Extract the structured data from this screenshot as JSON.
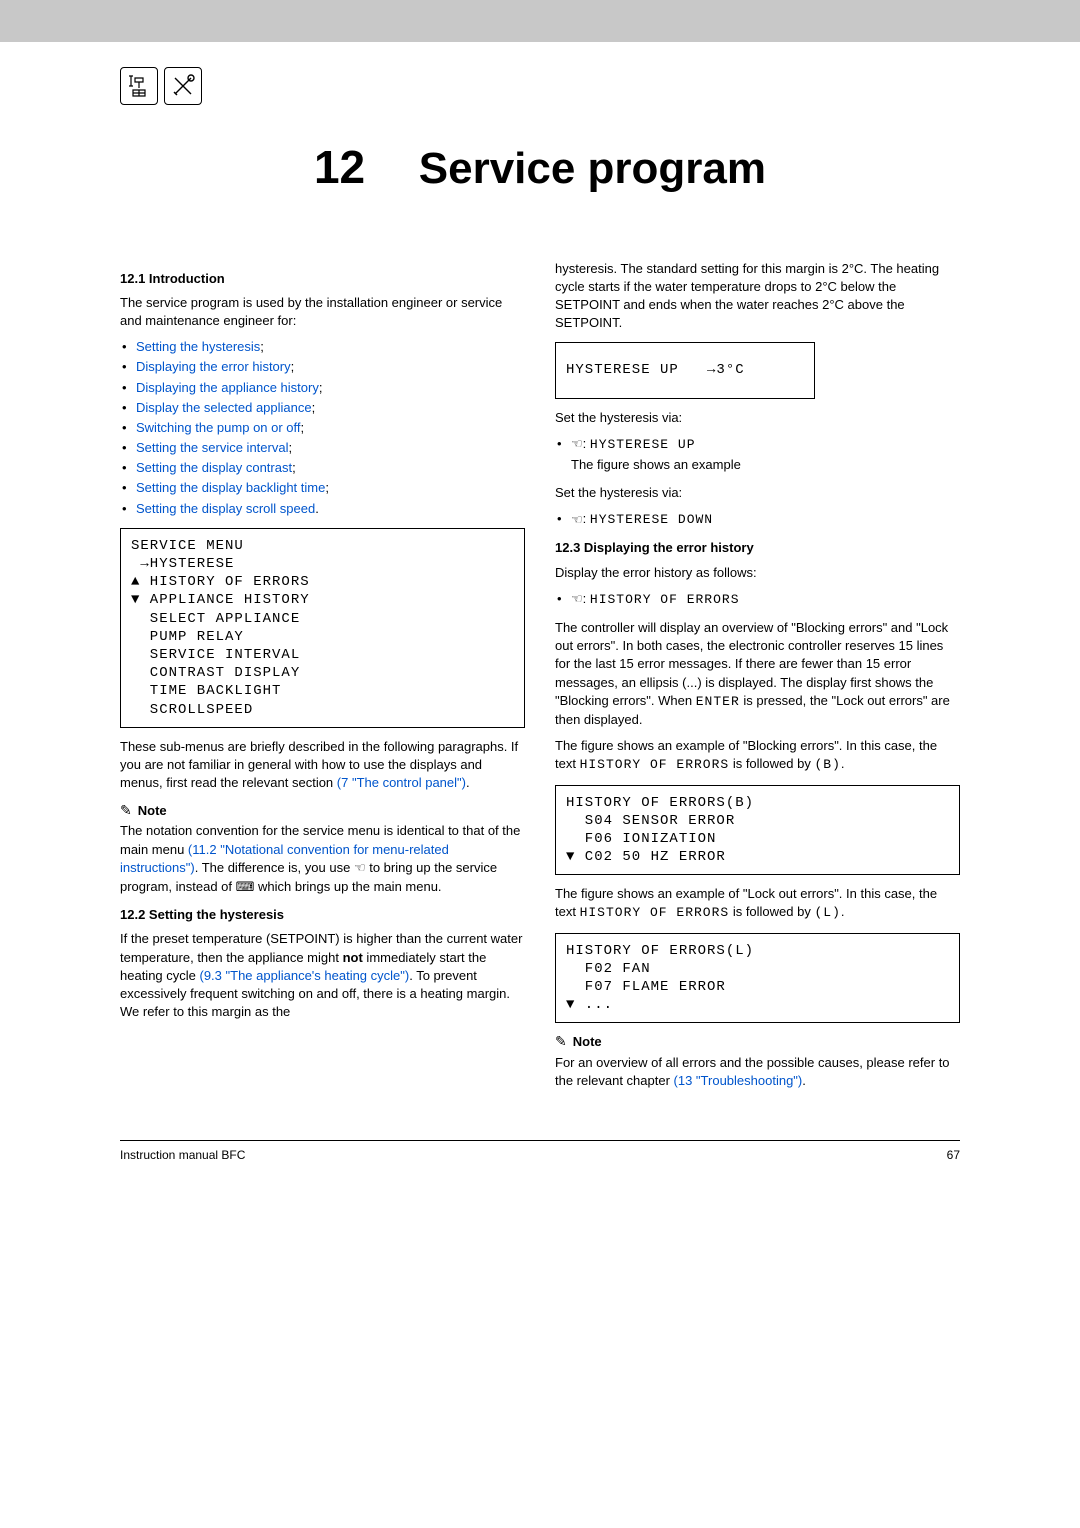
{
  "chapter": {
    "number": "12",
    "title": "Service program"
  },
  "s12_1": {
    "heading": "12.1   Introduction",
    "intro": "The service program is used by the installation engineer or service and maintenance engineer for:",
    "items": [
      "Setting the hysteresis",
      "Displaying the error history",
      "Displaying the appliance history",
      "Display the selected appliance",
      "Switching the pump on or off",
      "Setting the service interval",
      "Setting the display contrast",
      "Setting the display backlight time",
      "Setting the display scroll speed"
    ],
    "lcd": "SERVICE MENU\n →HYSTERESE\n▲ HISTORY OF ERRORS\n▼ APPLIANCE HISTORY\n  SELECT APPLIANCE\n  PUMP RELAY\n  SERVICE INTERVAL\n  CONTRAST DISPLAY\n  TIME BACKLIGHT\n  SCROLLSPEED",
    "after_lcd_1": "These sub-menus are briefly described in the following paragraphs. If you are not familiar in general with how to use the displays and menus, first read the relevant section ",
    "after_lcd_link": "(7 \"The control panel\")",
    "after_lcd_2": ".",
    "note_title": "Note",
    "note_1": "The notation convention for the service menu is identical to that of the main menu ",
    "note_link": "(11.2 \"Notational convention for menu-related instructions\")",
    "note_2": ". The difference is, you use ",
    "note_3": " to bring up the service program, instead of ",
    "note_4": " which brings up the main menu."
  },
  "s12_2": {
    "heading": "12.2   Setting the hysteresis",
    "p1_a": "If the preset temperature (SETPOINT) is higher than the current water temperature, then the appliance might ",
    "p1_bold": "not",
    "p1_b": " immediately start the heating cycle ",
    "p1_link": "(9.3 \"The appliance's heating cycle\")",
    "p1_c": ". To prevent excessively frequent switching on and off, there is a heating margin. We refer to this margin as the",
    "p2": "hysteresis. The standard setting for this margin is 2°C. The heating cycle starts if the water temperature drops to 2°C below the SETPOINT and ends when the water reaches 2°C above the SETPOINT.",
    "lcd": "HYSTERESE UP   →3°C",
    "set_via": "Set the hysteresis via:",
    "bul1": "HYSTERESE UP",
    "example": "The figure shows an example",
    "set_via2": "Set the hysteresis via:",
    "bul2": "HYSTERESE DOWN"
  },
  "s12_3": {
    "heading": "12.3   Displaying the error history",
    "intro": "Display the error history as follows:",
    "bul1": "HISTORY OF ERRORS",
    "p1_a": "The controller will display an overview of \"Blocking errors\" and \"Lock out errors\". In both cases, the electronic controller reserves 15 lines for the last 15 error messages. If there are fewer than 15 error messages, an ellipsis (...) is displayed. The display first shows the \"Blocking errors\". When ",
    "p1_enter": "ENTER",
    "p1_b": " is pressed, the \"Lock out errors\" are then displayed.",
    "p2_a": "The figure shows an example of \"Blocking errors\". In this case, the text ",
    "p2_mono": "HISTORY OF ERRORS",
    "p2_b": " is followed by ",
    "p2_tag": "(B)",
    "p2_c": ".",
    "lcdB": "HISTORY OF ERRORS(B)\n  S04 SENSOR ERROR\n  F06 IONIZATION\n▼ C02 50 HZ ERROR",
    "p3_a": "The figure shows an example of \"Lock out errors\". In this case, the text ",
    "p3_mono": "HISTORY OF ERRORS",
    "p3_b": " is followed by ",
    "p3_tag": "(L)",
    "p3_c": ".",
    "lcdL": "HISTORY OF ERRORS(L)\n  F02 FAN\n  F07 FLAME ERROR\n▼ ...",
    "note_title": "Note",
    "note_1": "For an overview of all errors and the possible causes, please refer to the relevant chapter ",
    "note_link": "(13 \"Troubleshooting\")",
    "note_2": "."
  },
  "footer": {
    "left": "Instruction manual BFC",
    "right": "67"
  }
}
